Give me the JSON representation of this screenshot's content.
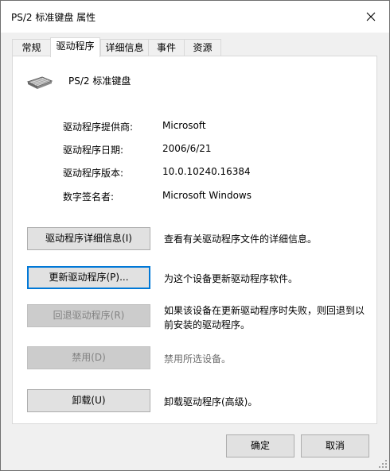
{
  "window": {
    "title": "PS/2 标准键盘 属性"
  },
  "tabs": [
    {
      "label": "常规"
    },
    {
      "label": "驱动程序"
    },
    {
      "label": "详细信息"
    },
    {
      "label": "事件"
    },
    {
      "label": "资源"
    }
  ],
  "active_tab": "驱动程序",
  "device": {
    "name": "PS/2 标准键盘",
    "icon": "keyboard-icon"
  },
  "info": [
    {
      "label": "驱动程序提供商:",
      "value": "Microsoft"
    },
    {
      "label": "驱动程序日期:",
      "value": "2006/6/21"
    },
    {
      "label": "驱动程序版本:",
      "value": "10.0.10240.16384"
    },
    {
      "label": "数字签名者:",
      "value": "Microsoft Windows"
    }
  ],
  "actions": [
    {
      "label": "驱动程序详细信息(I)",
      "description": "查看有关驱动程序文件的详细信息。",
      "enabled": true
    },
    {
      "label": "更新驱动程序(P)...",
      "description": "为这个设备更新驱动程序软件。",
      "enabled": true
    },
    {
      "label": "回退驱动程序(R)",
      "description": "如果该设备在更新驱动程序时失败，则回退到以前安装的驱动程序。",
      "enabled": false
    },
    {
      "label": "禁用(D)",
      "description": "禁用所选设备。",
      "enabled": false
    },
    {
      "label": "卸载(U)",
      "description": "卸载驱动程序(高级)。",
      "enabled": true
    }
  ],
  "footer": {
    "ok_label": "确定",
    "cancel_label": "取消"
  },
  "colors": {
    "focus_border": "#0078d7",
    "dialog_bg": "#f0f0f0",
    "panel_bg": "#ffffff"
  }
}
